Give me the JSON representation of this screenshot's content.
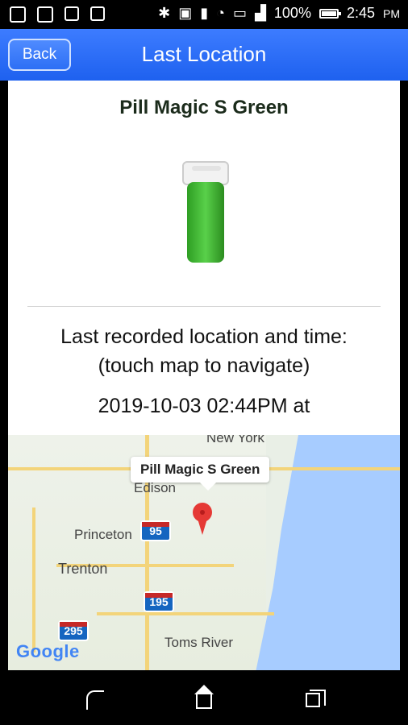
{
  "status_bar": {
    "battery_percent_text": "100%",
    "battery_level": 1.0,
    "time": "2:45",
    "time_suffix": "PM",
    "icons": [
      "back-arrow-icon",
      "gear-icon",
      "sim-icon",
      "pulse-icon",
      "bluetooth-icon",
      "nfc-icon",
      "vibrate-icon",
      "wifi-icon",
      "sd-icon",
      "signal-icon",
      "battery-icon"
    ]
  },
  "header": {
    "back_label": "Back",
    "title": "Last Location"
  },
  "content": {
    "product_name": "Pill Magic S Green",
    "info_line1": "Last recorded location and time:",
    "info_line2": "(touch map to navigate)",
    "datetime": "2019-10-03 02:44PM at"
  },
  "map": {
    "callout": "Pill Magic S Green",
    "labels": [
      "New York",
      "Edison",
      "Princeton",
      "Trenton",
      "Toms River"
    ],
    "shields": [
      "95",
      "195",
      "295"
    ],
    "google_logo": "Google"
  },
  "colors": {
    "header_top": "#3d7cff",
    "header_bottom": "#1e61ef",
    "pin": "#e53935",
    "sea": "#a7ccff"
  },
  "nav": {
    "icons": [
      "back-icon",
      "home-icon",
      "recent-apps-icon"
    ]
  }
}
